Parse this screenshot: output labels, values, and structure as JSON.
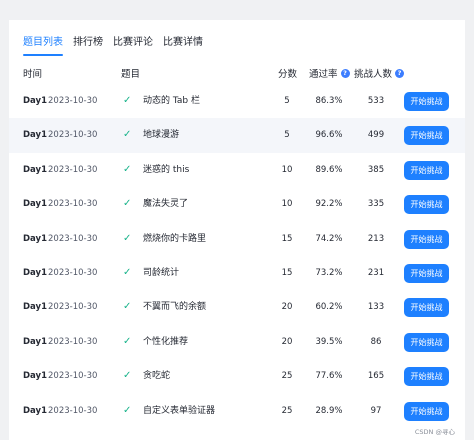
{
  "tabs": [
    {
      "label": "题目列表",
      "active": true
    },
    {
      "label": "排行榜",
      "active": false
    },
    {
      "label": "比赛评论",
      "active": false
    },
    {
      "label": "比赛详情",
      "active": false
    }
  ],
  "headers": {
    "time": "时间",
    "title": "题目",
    "score": "分数",
    "pass_rate": "通过率",
    "challengers": "挑战人数",
    "help_icon": "?"
  },
  "rows": [
    {
      "day": "Day1",
      "date": "2023-10-30",
      "title": "动态的 Tab 栏",
      "score": "5",
      "rate": "86.3%",
      "count": "533",
      "action": "开始挑战",
      "status_icon": "check-icon"
    },
    {
      "day": "Day1",
      "date": "2023-10-30",
      "title": "地球漫游",
      "score": "5",
      "rate": "96.6%",
      "count": "499",
      "action": "开始挑战",
      "status_icon": "check-icon"
    },
    {
      "day": "Day1",
      "date": "2023-10-30",
      "title": "迷惑的 this",
      "score": "10",
      "rate": "89.6%",
      "count": "385",
      "action": "开始挑战",
      "status_icon": "check-icon"
    },
    {
      "day": "Day1",
      "date": "2023-10-30",
      "title": "魔法失灵了",
      "score": "10",
      "rate": "92.2%",
      "count": "335",
      "action": "开始挑战",
      "status_icon": "check-icon"
    },
    {
      "day": "Day1",
      "date": "2023-10-30",
      "title": "燃烧你的卡路里",
      "score": "15",
      "rate": "74.2%",
      "count": "213",
      "action": "开始挑战",
      "status_icon": "check-icon"
    },
    {
      "day": "Day1",
      "date": "2023-10-30",
      "title": "司龄统计",
      "score": "15",
      "rate": "73.2%",
      "count": "231",
      "action": "开始挑战",
      "status_icon": "check-icon"
    },
    {
      "day": "Day1",
      "date": "2023-10-30",
      "title": "不翼而飞的余额",
      "score": "20",
      "rate": "60.2%",
      "count": "133",
      "action": "开始挑战",
      "status_icon": "check-icon"
    },
    {
      "day": "Day1",
      "date": "2023-10-30",
      "title": "个性化推荐",
      "score": "20",
      "rate": "39.5%",
      "count": "86",
      "action": "开始挑战",
      "status_icon": "check-icon"
    },
    {
      "day": "Day1",
      "date": "2023-10-30",
      "title": "贪吃蛇",
      "score": "25",
      "rate": "77.6%",
      "count": "165",
      "action": "开始挑战",
      "status_icon": "check-icon"
    },
    {
      "day": "Day1",
      "date": "2023-10-30",
      "title": "自定义表单验证器",
      "score": "25",
      "rate": "28.9%",
      "count": "97",
      "action": "开始挑战",
      "status_icon": "check-icon"
    }
  ],
  "watermark": "CSDN @寻心",
  "colors": {
    "accent": "#1e80ff",
    "check": "#18b38a",
    "row_highlight": "#f4f6fa"
  }
}
